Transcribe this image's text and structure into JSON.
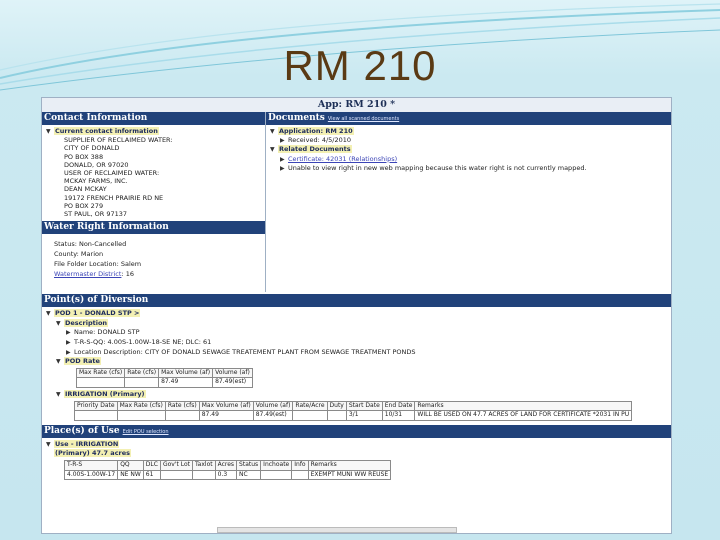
{
  "slide": {
    "title": "RM 210"
  },
  "app": {
    "title": "App: RM 210 *"
  },
  "contact": {
    "header": "Contact Information",
    "current_label": "Current contact information",
    "lines": [
      "SUPPLIER OF RECLAIMED WATER:",
      "CITY OF DONALD",
      "PO BOX 388",
      "DONALD, OR 97020",
      "USER OF RECLAIMED WATER:",
      "MCKAY FARMS, INC.",
      "DEAN MCKAY",
      "19172 FRENCH PRAIRIE RD NE",
      "PO BOX 279",
      "ST PAUL, OR 97137"
    ]
  },
  "documents": {
    "header": "Documents",
    "header_link": "View all scanned documents",
    "application_label": "Application: RM 210",
    "received": "Received: 4/5/2010",
    "related_label": "Related Documents",
    "certificate_link": "Certificate: 42031 (Relationships)",
    "unable_note": "Unable to view right in new web mapping because this water right is not currently mapped."
  },
  "water_right": {
    "header": "Water Right Information",
    "status": "Status: Non-Cancelled",
    "county": "County: Marion",
    "file_folder": "File Folder Location: Salem",
    "watermaster_link": "Watermaster District",
    "watermaster_value": ": 16"
  },
  "pod": {
    "header": "Point(s) of Diversion",
    "pod_label": "POD 1 - DONALD STP >",
    "description_label": "Description",
    "name": "Name: DONALD STP",
    "trsqq": "T-R-S-QQ: 4.00S-1.00W-18-SE NE; DLC: 61",
    "location": "Location Description: CITY OF DONALD SEWAGE TREATEMENT PLANT FROM SEWAGE TREATMENT PONDS",
    "rate_label": "POD Rate",
    "rate_headers": [
      "Max Rate (cfs)",
      "Rate (cfs)",
      "Max Volume (af)",
      "Volume (af)"
    ],
    "rate_row": [
      "",
      "",
      "87.49",
      "87.49(est)"
    ],
    "irrigation_label": "IRRIGATION (Primary)",
    "irr_headers": [
      "Priority Date",
      "Max Rate (cfs)",
      "Rate (cfs)",
      "Max Volume (af)",
      "Volume (af)",
      "Rate/Acre",
      "Duty",
      "Start Date",
      "End Date",
      "Remarks"
    ],
    "irr_row": [
      "",
      "",
      "",
      "87.49",
      "87.49(est)",
      "",
      "",
      "3/1",
      "10/31",
      "WILL BE USED ON 47.7 ACRES OF LAND FOR CERTIFICATE *2031 IN PU"
    ]
  },
  "place_of_use": {
    "header": "Place(s) of Use",
    "header_link": "Edit POU selection",
    "use_label": "Use - IRRIGATION",
    "primary_label": "(Primary)  47.7 acres",
    "headers": [
      "T-R-S",
      "QQ",
      "DLC",
      "Gov't Lot",
      "Taxlot",
      "Acres",
      "Status",
      "Inchoate",
      "Info",
      "Remarks"
    ],
    "row": [
      "4.00S-1.00W-17",
      "NE NW",
      "61",
      "",
      "",
      "0.3",
      "NC",
      "",
      "",
      "EXEMPT MUNI WW REUSE"
    ]
  }
}
